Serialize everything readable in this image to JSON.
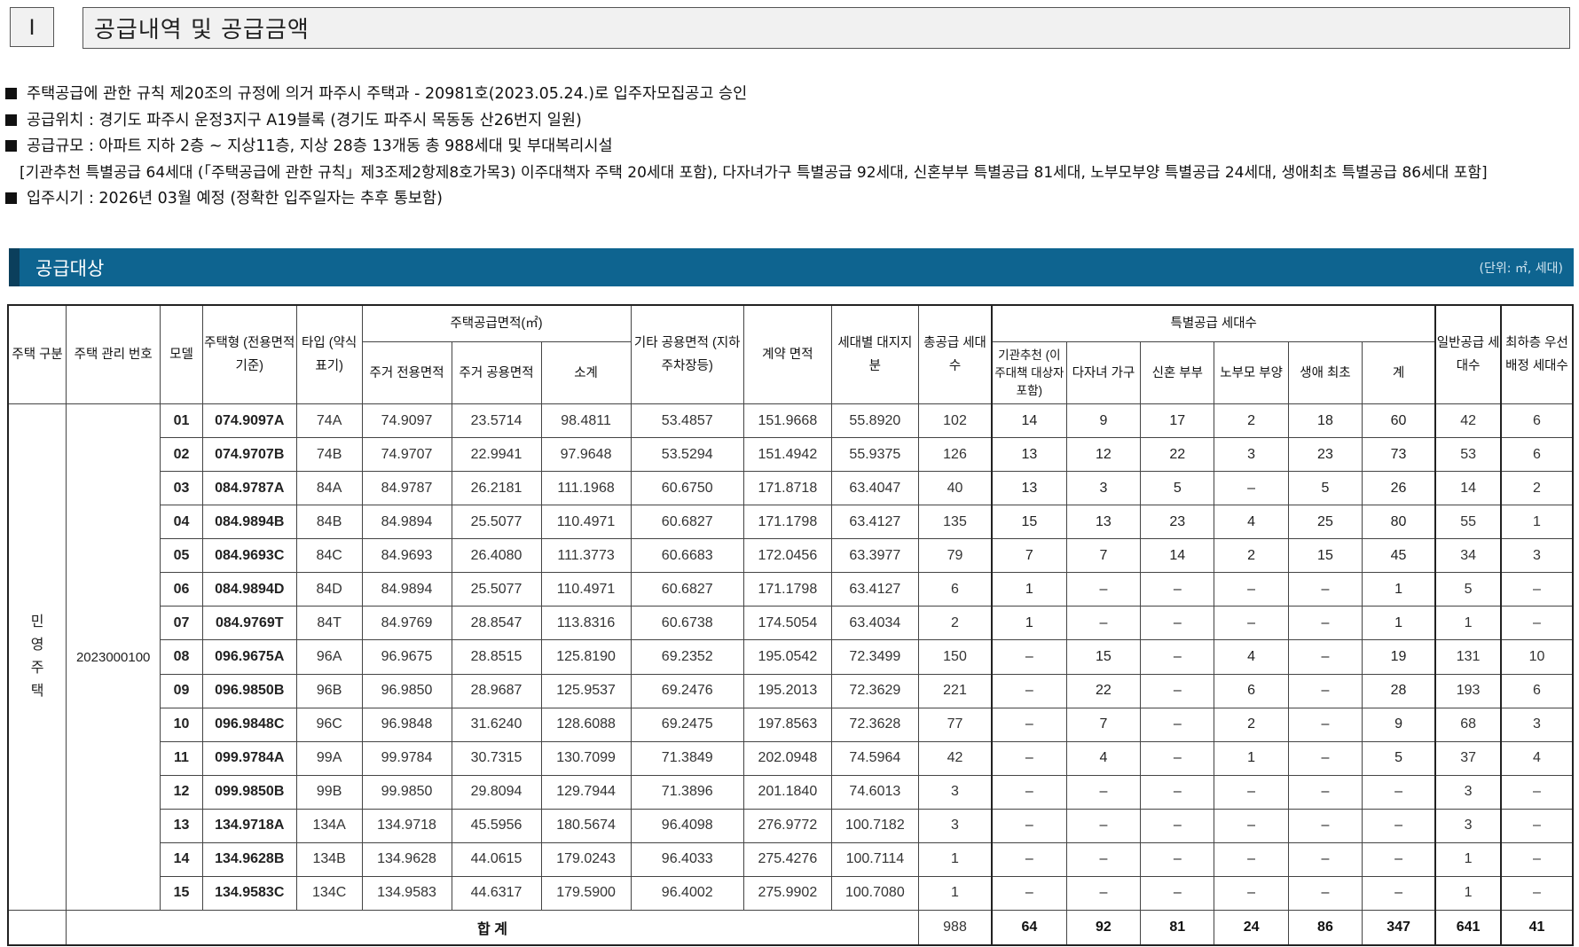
{
  "section": {
    "num": "Ⅰ",
    "title": "공급내역 및 공급금액"
  },
  "bullets": [
    "주택공급에 관한 규칙 제20조의 규정에 의거 파주시 주택과 - 20981호(2023.05.24.)로 입주자모집공고 승인",
    "공급위치 : 경기도 파주시 운정3지구 A19블록 (경기도 파주시 목동동 산26번지 일원)",
    "공급규모 : 아파트 지하 2층 ~ 지상11층, 지상 28층 13개동 총 988세대 및 부대복리시설",
    "[기관추천 특별공급 64세대 (「주택공급에 관한 규칙」제3조제2항제8호가목3) 이주대책자 주택 20세대 포함), 다자녀가구 특별공급 92세대, 신혼부부 특별공급 81세대, 노부모부양 특별공급 24세대, 생애최초 특별공급 86세대 포함]",
    "입주시기 : 2026년 03월 예정 (정확한 입주일자는 추후 통보함)"
  ],
  "banner": {
    "title": "공급대상",
    "unit": "(단위: ㎡, 세대)"
  },
  "colors": {
    "banner_bg": "#0e6490",
    "banner_edge": "#0b3f5c",
    "header_box": "#f1f1f1"
  },
  "table": {
    "headers": {
      "housing_type": "주택 구분",
      "mgmt_no": "주택 관리 번호",
      "model": "모델",
      "unit_type": "주택형 (전용면적 기준)",
      "type_short": "타입 (약식 표기)",
      "area_group": "주택공급면적(㎡)",
      "exclusive": "주거 전용면적",
      "common": "주거 공용면적",
      "subtotal": "소계",
      "other_common": "기타 공용면적 (지하주차장등)",
      "contract": "계약 면적",
      "land": "세대별 대지지분",
      "total_units": "총공급 세대수",
      "special_group": "특별공급 세대수",
      "institution": "기관추천 (이주대책 대상자 포함)",
      "multi_child": "다자녀 가구",
      "newlywed": "신혼 부부",
      "elderly": "노부모 부양",
      "first_life": "생애 최초",
      "special_total": "계",
      "general": "일반공급 세대수",
      "lowest_floor": "최하층 우선배정 세대수"
    },
    "category": "민영주택",
    "category_chars": [
      "민",
      "영",
      "주",
      "택"
    ],
    "mgmt_no": "2023000100",
    "rows": [
      {
        "model": "01",
        "type": "074.9097A",
        "short": "74A",
        "exclusive": "74.9097",
        "common": "23.5714",
        "subtotal": "98.4811",
        "other": "53.4857",
        "contract": "151.9668",
        "land": "55.8920",
        "total": "102",
        "inst": "14",
        "multi": "9",
        "newly": "17",
        "elder": "2",
        "first": "18",
        "sp_total": "60",
        "general": "42",
        "lowest": "6"
      },
      {
        "model": "02",
        "type": "074.9707B",
        "short": "74B",
        "exclusive": "74.9707",
        "common": "22.9941",
        "subtotal": "97.9648",
        "other": "53.5294",
        "contract": "151.4942",
        "land": "55.9375",
        "total": "126",
        "inst": "13",
        "multi": "12",
        "newly": "22",
        "elder": "3",
        "first": "23",
        "sp_total": "73",
        "general": "53",
        "lowest": "6"
      },
      {
        "model": "03",
        "type": "084.9787A",
        "short": "84A",
        "exclusive": "84.9787",
        "common": "26.2181",
        "subtotal": "111.1968",
        "other": "60.6750",
        "contract": "171.8718",
        "land": "63.4047",
        "total": "40",
        "inst": "13",
        "multi": "3",
        "newly": "5",
        "elder": "–",
        "first": "5",
        "sp_total": "26",
        "general": "14",
        "lowest": "2"
      },
      {
        "model": "04",
        "type": "084.9894B",
        "short": "84B",
        "exclusive": "84.9894",
        "common": "25.5077",
        "subtotal": "110.4971",
        "other": "60.6827",
        "contract": "171.1798",
        "land": "63.4127",
        "total": "135",
        "inst": "15",
        "multi": "13",
        "newly": "23",
        "elder": "4",
        "first": "25",
        "sp_total": "80",
        "general": "55",
        "lowest": "1"
      },
      {
        "model": "05",
        "type": "084.9693C",
        "short": "84C",
        "exclusive": "84.9693",
        "common": "26.4080",
        "subtotal": "111.3773",
        "other": "60.6683",
        "contract": "172.0456",
        "land": "63.3977",
        "total": "79",
        "inst": "7",
        "multi": "7",
        "newly": "14",
        "elder": "2",
        "first": "15",
        "sp_total": "45",
        "general": "34",
        "lowest": "3"
      },
      {
        "model": "06",
        "type": "084.9894D",
        "short": "84D",
        "exclusive": "84.9894",
        "common": "25.5077",
        "subtotal": "110.4971",
        "other": "60.6827",
        "contract": "171.1798",
        "land": "63.4127",
        "total": "6",
        "inst": "1",
        "multi": "–",
        "newly": "–",
        "elder": "–",
        "first": "–",
        "sp_total": "1",
        "general": "5",
        "lowest": "–"
      },
      {
        "model": "07",
        "type": "084.9769T",
        "short": "84T",
        "exclusive": "84.9769",
        "common": "28.8547",
        "subtotal": "113.8316",
        "other": "60.6738",
        "contract": "174.5054",
        "land": "63.4034",
        "total": "2",
        "inst": "1",
        "multi": "–",
        "newly": "–",
        "elder": "–",
        "first": "–",
        "sp_total": "1",
        "general": "1",
        "lowest": "–"
      },
      {
        "model": "08",
        "type": "096.9675A",
        "short": "96A",
        "exclusive": "96.9675",
        "common": "28.8515",
        "subtotal": "125.8190",
        "other": "69.2352",
        "contract": "195.0542",
        "land": "72.3499",
        "total": "150",
        "inst": "–",
        "multi": "15",
        "newly": "–",
        "elder": "4",
        "first": "–",
        "sp_total": "19",
        "general": "131",
        "lowest": "10"
      },
      {
        "model": "09",
        "type": "096.9850B",
        "short": "96B",
        "exclusive": "96.9850",
        "common": "28.9687",
        "subtotal": "125.9537",
        "other": "69.2476",
        "contract": "195.2013",
        "land": "72.3629",
        "total": "221",
        "inst": "–",
        "multi": "22",
        "newly": "–",
        "elder": "6",
        "first": "–",
        "sp_total": "28",
        "general": "193",
        "lowest": "6"
      },
      {
        "model": "10",
        "type": "096.9848C",
        "short": "96C",
        "exclusive": "96.9848",
        "common": "31.6240",
        "subtotal": "128.6088",
        "other": "69.2475",
        "contract": "197.8563",
        "land": "72.3628",
        "total": "77",
        "inst": "–",
        "multi": "7",
        "newly": "–",
        "elder": "2",
        "first": "–",
        "sp_total": "9",
        "general": "68",
        "lowest": "3"
      },
      {
        "model": "11",
        "type": "099.9784A",
        "short": "99A",
        "exclusive": "99.9784",
        "common": "30.7315",
        "subtotal": "130.7099",
        "other": "71.3849",
        "contract": "202.0948",
        "land": "74.5964",
        "total": "42",
        "inst": "–",
        "multi": "4",
        "newly": "–",
        "elder": "1",
        "first": "–",
        "sp_total": "5",
        "general": "37",
        "lowest": "4"
      },
      {
        "model": "12",
        "type": "099.9850B",
        "short": "99B",
        "exclusive": "99.9850",
        "common": "29.8094",
        "subtotal": "129.7944",
        "other": "71.3896",
        "contract": "201.1840",
        "land": "74.6013",
        "total": "3",
        "inst": "–",
        "multi": "–",
        "newly": "–",
        "elder": "–",
        "first": "–",
        "sp_total": "–",
        "general": "3",
        "lowest": "–"
      },
      {
        "model": "13",
        "type": "134.9718A",
        "short": "134A",
        "exclusive": "134.9718",
        "common": "45.5956",
        "subtotal": "180.5674",
        "other": "96.4098",
        "contract": "276.9772",
        "land": "100.7182",
        "total": "3",
        "inst": "–",
        "multi": "–",
        "newly": "–",
        "elder": "–",
        "first": "–",
        "sp_total": "–",
        "general": "3",
        "lowest": "–"
      },
      {
        "model": "14",
        "type": "134.9628B",
        "short": "134B",
        "exclusive": "134.9628",
        "common": "44.0615",
        "subtotal": "179.0243",
        "other": "96.4033",
        "contract": "275.4276",
        "land": "100.7114",
        "total": "1",
        "inst": "–",
        "multi": "–",
        "newly": "–",
        "elder": "–",
        "first": "–",
        "sp_total": "–",
        "general": "1",
        "lowest": "–"
      },
      {
        "model": "15",
        "type": "134.9583C",
        "short": "134C",
        "exclusive": "134.9583",
        "common": "44.6317",
        "subtotal": "179.5900",
        "other": "96.4002",
        "contract": "275.9902",
        "land": "100.7080",
        "total": "1",
        "inst": "–",
        "multi": "–",
        "newly": "–",
        "elder": "–",
        "first": "–",
        "sp_total": "–",
        "general": "1",
        "lowest": "–"
      }
    ],
    "totals": {
      "label": "합 계",
      "total": "988",
      "inst": "64",
      "multi": "92",
      "newly": "81",
      "elder": "24",
      "first": "86",
      "sp_total": "347",
      "general": "641",
      "lowest": "41"
    }
  }
}
